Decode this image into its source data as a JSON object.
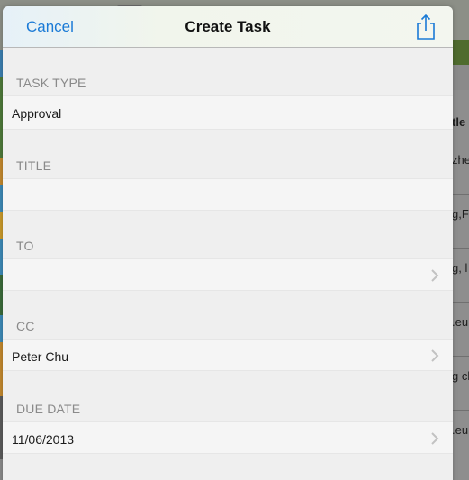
{
  "background": {
    "table_header": "tle",
    "cells": [
      "zhe",
      "g,F",
      "g, l",
      ".eu",
      "g cl",
      ".eu"
    ]
  },
  "nav": {
    "cancel_label": "Cancel",
    "title": "Create Task",
    "share_icon": "share-icon",
    "accent_color": "#1a7ad6"
  },
  "form": {
    "task_type": {
      "label": "TASK TYPE",
      "value": "Approval"
    },
    "title": {
      "label": "TITLE",
      "value": ""
    },
    "to": {
      "label": "TO",
      "value": ""
    },
    "cc": {
      "label": "CC",
      "value": "Peter Chu"
    },
    "due_date": {
      "label": "DUE DATE",
      "value": "11/06/2013"
    }
  }
}
